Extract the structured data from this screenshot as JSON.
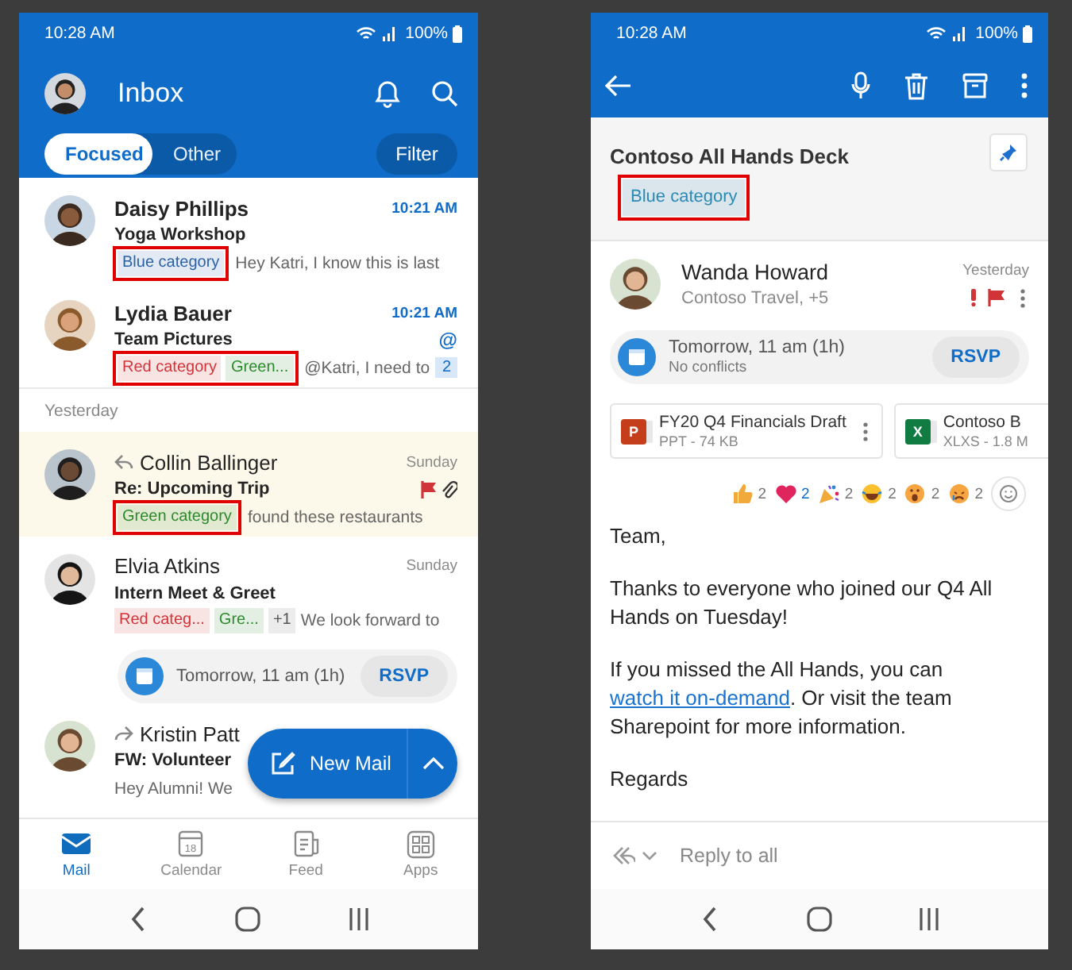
{
  "inbox": {
    "status_bar": {
      "time": "10:28 AM",
      "battery": "100%"
    },
    "title": "Inbox",
    "tabs": [
      {
        "label": "Focused",
        "selected": true
      },
      {
        "label": "Other",
        "selected": false
      }
    ],
    "filter": "Filter",
    "groups": [
      {
        "messages": [
          {
            "sender": "Daisy Phillips",
            "time": "10:21 AM",
            "unread": true,
            "subject": "Yoga Workshop",
            "categories": [
              {
                "label": "Blue category",
                "color": "#2b63a8"
              }
            ],
            "annotated": true,
            "preview": "Hey Katri, I know this is last"
          },
          {
            "sender": "Lydia Bauer",
            "time": "10:21 AM",
            "unread": true,
            "subject": "Team Pictures",
            "mention": "@",
            "categories": [
              {
                "label": "Red category",
                "color": "#d13438"
              },
              {
                "label": "Green...",
                "color": "#2b8a2b"
              }
            ],
            "annotated": true,
            "preview": "@Katri, I need to",
            "thread_count": "2"
          }
        ]
      },
      {
        "title": "Yesterday",
        "messages": [
          {
            "sender": "Collin Ballinger",
            "replied": true,
            "time": "Sunday",
            "unread": false,
            "highlighted": true,
            "subject": "Re: Upcoming Trip",
            "flagged": true,
            "attachment": true,
            "categories": [
              {
                "label": "Green category",
                "color": "#2b8a2b"
              }
            ],
            "annotated": true,
            "preview": "found these restaurants"
          },
          {
            "sender": "Elvia Atkins",
            "time": "Sunday",
            "unread": false,
            "subject": "Intern Meet & Greet",
            "categories": [
              {
                "label": "Red categ...",
                "color": "#d13438"
              },
              {
                "label": "Gre...",
                "color": "#2b8a2b"
              }
            ],
            "more": "+1",
            "preview": "We look forward to",
            "event": {
              "text": "Tomorrow, 11 am (1h)",
              "button": "RSVP"
            }
          },
          {
            "sender": "Kristin Patt",
            "forwarded": true,
            "unread": false,
            "subject": "FW: Volunteer",
            "preview": "Hey Alumni! We"
          }
        ]
      }
    ],
    "new_mail": "New Mail",
    "bottom_tabs": [
      {
        "kind": "mail",
        "label": "Mail",
        "selected": true
      },
      {
        "kind": "calendar",
        "label": "Calendar",
        "date": "18",
        "selected": false
      },
      {
        "kind": "feed",
        "label": "Feed",
        "selected": false
      },
      {
        "kind": "apps",
        "label": "Apps",
        "selected": false
      }
    ]
  },
  "message": {
    "status_bar": {
      "time": "10:28 AM",
      "battery": "100%"
    },
    "subject": "Contoso All Hands Deck",
    "category": {
      "label": "Blue category",
      "color": "#2a8ab5"
    },
    "annotated": true,
    "sender": "Wanda Howard",
    "recipients": "Contoso Travel, +5",
    "time": "Yesterday",
    "important": true,
    "flagged": true,
    "event": {
      "text": "Tomorrow, 11 am (1h)",
      "note": "No conflicts",
      "button": "RSVP"
    },
    "attachments": [
      {
        "kind": "ppt",
        "badge": "P",
        "name": "FY20 Q4 Financials Draft",
        "details": "PPT - 74 KB"
      },
      {
        "kind": "xls",
        "badge": "X",
        "name": "Contoso B",
        "details": "XLXS - 1.8 M"
      }
    ],
    "reactions": [
      {
        "kind": "thumbs_up",
        "count": "2",
        "selected": false
      },
      {
        "kind": "heart",
        "count": "2",
        "selected": true
      },
      {
        "kind": "confetti",
        "count": "2",
        "selected": false
      },
      {
        "kind": "laugh",
        "count": "2",
        "selected": false
      },
      {
        "kind": "surprised",
        "count": "2",
        "selected": false
      },
      {
        "kind": "sad",
        "count": "2",
        "selected": false
      }
    ],
    "body": [
      {
        "text": "Team,"
      },
      {
        "text": "Thanks to everyone who joined our Q4 All Hands on Tuesday!"
      },
      {
        "text": "If you missed the All Hands, you can ",
        "link": "watch it on-demand",
        "after": ". Or visit the team Sharepoint for more information."
      },
      {
        "text": "Regards"
      }
    ],
    "reply": "Reply to all"
  }
}
